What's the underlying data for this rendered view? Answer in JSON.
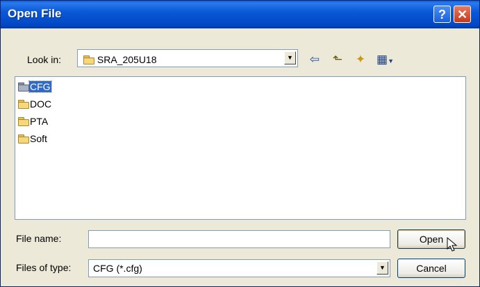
{
  "window": {
    "title": "Open File"
  },
  "titlebar": {
    "help_glyph": "?",
    "close_glyph": "✕"
  },
  "lookin": {
    "label": "Look in:",
    "value": "SRA_205U18"
  },
  "toolbar": {
    "back_glyph": "⇦",
    "up_glyph": "⬑",
    "newfolder_glyph": "✦",
    "views_glyph": "▦"
  },
  "files": [
    {
      "name": "CFG",
      "selected": true
    },
    {
      "name": "DOC",
      "selected": false
    },
    {
      "name": "PTA",
      "selected": false
    },
    {
      "name": "Soft",
      "selected": false
    }
  ],
  "filename": {
    "label": "File name:",
    "value": ""
  },
  "filetype": {
    "label": "Files of type:",
    "value": "CFG (*.cfg)"
  },
  "buttons": {
    "open": "Open",
    "cancel": "Cancel"
  }
}
